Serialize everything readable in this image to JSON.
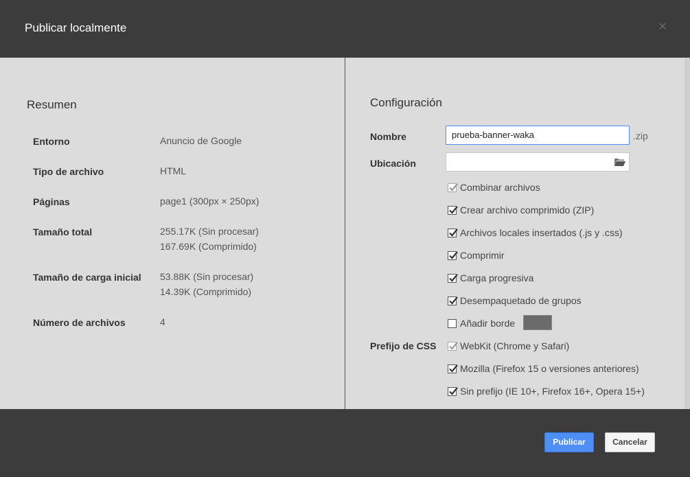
{
  "dialog": {
    "title": "Publicar localmente",
    "close_glyph": "×"
  },
  "summary": {
    "title": "Resumen",
    "rows": [
      {
        "label": "Entorno",
        "values": [
          "Anuncio de Google"
        ]
      },
      {
        "label": "Tipo de archivo",
        "values": [
          "HTML"
        ]
      },
      {
        "label": "Páginas",
        "values": [
          "page1 (300px × 250px)"
        ]
      },
      {
        "label": "Tamaño total",
        "values": [
          "255.17K (Sin procesar)",
          "167.69K (Comprimido)"
        ]
      },
      {
        "label": "Tamaño de carga inicial",
        "values": [
          "53.88K (Sin procesar)",
          "14.39K (Comprimido)"
        ]
      },
      {
        "label": "Número de archivos",
        "values": [
          "4"
        ]
      }
    ]
  },
  "config": {
    "title": "Configuración",
    "name_label": "Nombre",
    "name_value": "prueba-banner-waka",
    "name_suffix": ".zip",
    "location_label": "Ubicación",
    "location_value": "",
    "options": [
      {
        "label": "Combinar archivos",
        "checked": true,
        "disabled": true
      },
      {
        "label": "Crear archivo comprimido (ZIP)",
        "checked": true,
        "disabled": false
      },
      {
        "label": "Archivos locales insertados (.js y .css)",
        "checked": true,
        "disabled": false
      },
      {
        "label": "Comprimir",
        "checked": true,
        "disabled": false
      },
      {
        "label": "Carga progresiva",
        "checked": true,
        "disabled": false
      },
      {
        "label": "Desempaquetado de grupos",
        "checked": true,
        "disabled": false
      },
      {
        "label": "Añadir borde",
        "checked": false,
        "disabled": false
      }
    ],
    "border_color": "#6b6b6b",
    "css_prefix_label": "Prefijo de CSS",
    "css_prefix_options": [
      {
        "label": "WebKit (Chrome y Safari)",
        "checked": true,
        "disabled": true
      },
      {
        "label": "Mozilla (Firefox 15 o versiones anteriores)",
        "checked": true,
        "disabled": false
      },
      {
        "label": "Sin prefijo (IE 10+, Firefox 16+, Opera 15+)",
        "checked": true,
        "disabled": false
      }
    ]
  },
  "footer": {
    "publish_label": "Publicar",
    "cancel_label": "Cancelar"
  },
  "colors": {
    "accent": "#4d8ff5",
    "chrome": "#3c3c3c",
    "panel": "#dcdcdc"
  },
  "icons": {
    "close": "close-icon",
    "folder": "folder-icon",
    "check": "checkmark-icon"
  }
}
